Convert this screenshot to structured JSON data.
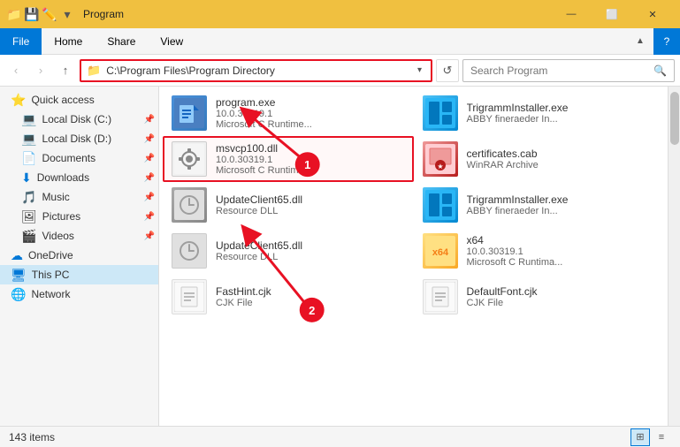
{
  "titleBar": {
    "title": "Program",
    "icons": [
      "📁",
      "💾",
      "✏️"
    ],
    "controls": [
      "—",
      "⬜",
      "✕"
    ]
  },
  "ribbon": {
    "tabs": [
      "File",
      "Home",
      "Share",
      "View"
    ],
    "activeTab": "File"
  },
  "addressBar": {
    "path": "C:\\Program Files\\Program Directory",
    "searchPlaceholder": "Search Program",
    "searchLabel": "Search Program"
  },
  "sidebar": {
    "items": [
      {
        "id": "quick-access",
        "label": "Quick access",
        "icon": "⭐",
        "pinned": false
      },
      {
        "id": "local-disk-c",
        "label": "Local Disk (C:)",
        "icon": "💻",
        "pinned": true
      },
      {
        "id": "local-disk-d",
        "label": "Local Disk (D:)",
        "icon": "💻",
        "pinned": true
      },
      {
        "id": "documents",
        "label": "Documents",
        "icon": "📄",
        "pinned": true
      },
      {
        "id": "downloads",
        "label": "Downloads",
        "icon": "⬇",
        "pinned": true
      },
      {
        "id": "music",
        "label": "Music",
        "icon": "🎵",
        "pinned": true
      },
      {
        "id": "pictures",
        "label": "Pictures",
        "icon": "🖼",
        "pinned": true
      },
      {
        "id": "videos",
        "label": "Videos",
        "icon": "🎬",
        "pinned": true
      },
      {
        "id": "onedrive",
        "label": "OneDrive",
        "icon": "☁",
        "pinned": false
      },
      {
        "id": "this-pc",
        "label": "This PC",
        "icon": "🖥",
        "pinned": false,
        "active": true
      },
      {
        "id": "network",
        "label": "Network",
        "icon": "🌐",
        "pinned": false
      }
    ]
  },
  "files": [
    {
      "id": "program-exe",
      "name": "program.exe",
      "version": "10.0.30319.1",
      "type": "Microsoft C Runtime...",
      "iconType": "exe",
      "selected": false
    },
    {
      "id": "trigramm-installer-1",
      "name": "TrigrammInstaller.exe",
      "version": "ABBY fineraeder In...",
      "type": "",
      "iconType": "trigramm",
      "selected": false
    },
    {
      "id": "msvcp100-dll",
      "name": "msvcp100.dll",
      "version": "10.0.30319.1",
      "type": "Microsoft C Runtime...",
      "iconType": "dll",
      "selected": true
    },
    {
      "id": "certificates-cab",
      "name": "certificates.cab",
      "version": "WinRAR Archive",
      "type": "",
      "iconType": "cert",
      "selected": false
    },
    {
      "id": "updateclient65-dll-1",
      "name": "UpdateClient65.dll",
      "version": "Resource DLL",
      "type": "",
      "iconType": "update",
      "selected": false
    },
    {
      "id": "trigramm-installer-2",
      "name": "TrigrammInstaller.exe",
      "version": "ABBY fineraeder In...",
      "type": "",
      "iconType": "trigramm2",
      "selected": false
    },
    {
      "id": "updateclient65-dll-2",
      "name": "UpdateClient65.dll",
      "version": "Resource DLL",
      "type": "",
      "iconType": "update2",
      "selected": false
    },
    {
      "id": "x64",
      "name": "x64",
      "version": "10.0.30319.1",
      "type": "Microsoft C Runtima...",
      "iconType": "x64",
      "selected": false
    },
    {
      "id": "fasthint-cjk",
      "name": "FastHint.cjk",
      "version": "CJK File",
      "type": "",
      "iconType": "fasthint",
      "selected": false
    },
    {
      "id": "defaultfont-cjk",
      "name": "DefaultFont.cjk",
      "version": "CJK File",
      "type": "",
      "iconType": "default",
      "selected": false
    }
  ],
  "statusBar": {
    "itemCount": "143 items",
    "viewModes": [
      "grid",
      "list"
    ]
  },
  "annotations": [
    {
      "number": "1",
      "desc": "Address bar annotation"
    },
    {
      "number": "2",
      "desc": "File item annotation"
    }
  ]
}
